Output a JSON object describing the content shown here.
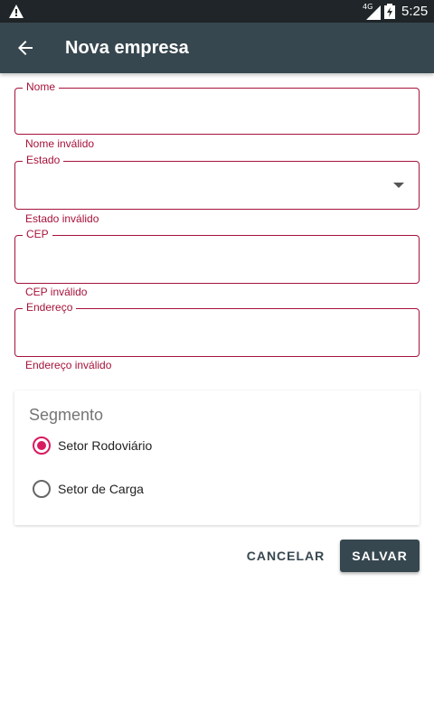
{
  "status_bar": {
    "time": "5:25",
    "network": "4G"
  },
  "app_bar": {
    "title": "Nova empresa"
  },
  "fields": {
    "nome": {
      "label": "Nome",
      "value": "",
      "error": "Nome inválido"
    },
    "estado": {
      "label": "Estado",
      "value": "",
      "error": "Estado inválido"
    },
    "cep": {
      "label": "CEP",
      "value": "",
      "error": "CEP inválido"
    },
    "endereco": {
      "label": "Endereço",
      "value": "",
      "error": "Endereço inválido"
    }
  },
  "segmento": {
    "title": "Segmento",
    "options": [
      {
        "label": "Setor Rodoviário",
        "selected": true
      },
      {
        "label": "Setor de Carga",
        "selected": false
      }
    ]
  },
  "actions": {
    "cancel": "CANCELAR",
    "save": "SALVAR"
  },
  "colors": {
    "primary": "#37474f",
    "error": "#a6123a",
    "accent": "#d81b60"
  }
}
